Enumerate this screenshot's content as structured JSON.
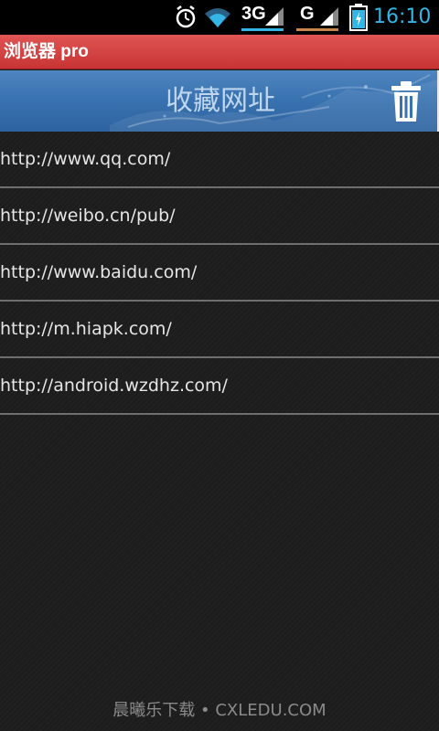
{
  "status_bar": {
    "time": "16:10",
    "network1_label": "3G",
    "network2_label": "G",
    "icons": [
      "alarm-icon",
      "wifi-icon",
      "signal-icon",
      "signal-icon",
      "battery-icon"
    ],
    "time_color": "#33b5e5"
  },
  "app": {
    "title": "浏览器 pro",
    "title_bar_color": "#d94444"
  },
  "banner": {
    "title": "收藏网址",
    "delete_icon": "trash-icon",
    "color": "#3a73b1"
  },
  "bookmarks": [
    {
      "url": "http://www.qq.com/"
    },
    {
      "url": "http://weibo.cn/pub/"
    },
    {
      "url": "http://www.baidu.com/"
    },
    {
      "url": "http://m.hiapk.com/"
    },
    {
      "url": "http://android.wzdhz.com/"
    }
  ],
  "watermark": "晨曦乐下载 • CXLEDU.COM"
}
